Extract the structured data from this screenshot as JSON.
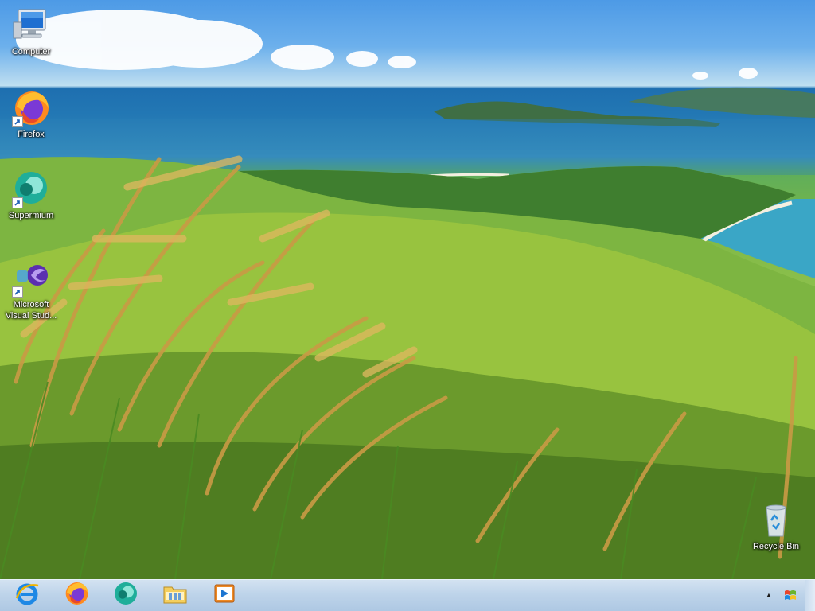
{
  "desktop": {
    "icons": [
      {
        "label": "Computer",
        "icon": "computer-icon"
      },
      {
        "label": "Firefox",
        "icon": "firefox-icon"
      },
      {
        "label": "Supermium",
        "icon": "supermium-icon"
      },
      {
        "label": "Microsoft Visual Stud...",
        "icon": "visual-studio-icon"
      },
      {
        "label": "Recycle Bin",
        "icon": "recycle-bin-icon"
      }
    ]
  },
  "taskbar": {
    "pinned": [
      {
        "name": "internet-explorer",
        "icon": "internet-explorer-icon"
      },
      {
        "name": "firefox",
        "icon": "firefox-icon"
      },
      {
        "name": "supermium",
        "icon": "supermium-icon"
      },
      {
        "name": "file-explorer",
        "icon": "folder-icon"
      },
      {
        "name": "media-player",
        "icon": "media-player-icon"
      }
    ],
    "tray_arrow": "▲",
    "start_flag": "windows-flag-icon"
  },
  "colors": {
    "taskbar": "#bed4ea",
    "sky": "#4d9ae6",
    "sea": "#1e6fb0",
    "grass": "#7fb845"
  }
}
